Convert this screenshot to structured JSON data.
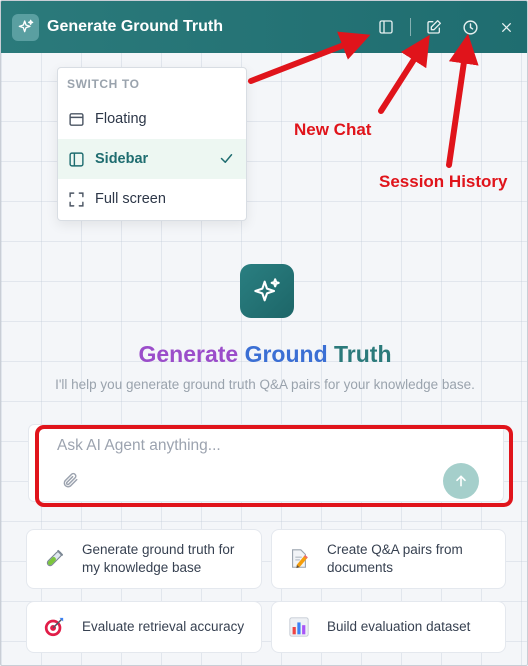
{
  "header": {
    "title": "Generate Ground Truth",
    "icons": [
      "sparkle-icon",
      "sidebar-toggle-icon",
      "new-chat-icon",
      "history-icon",
      "close-icon"
    ]
  },
  "switch_menu": {
    "heading": "SWITCH TO",
    "items": [
      {
        "label": "Floating",
        "icon": "floating-window-icon",
        "active": false
      },
      {
        "label": "Sidebar",
        "icon": "sidebar-icon",
        "active": true
      },
      {
        "label": "Full screen",
        "icon": "fullscreen-icon",
        "active": false
      }
    ]
  },
  "annotations": {
    "new_chat": "New Chat",
    "session_history": "Session History"
  },
  "hero": {
    "title_part1": "Generate",
    "title_part2": "Ground",
    "title_part3": "Truth",
    "subtitle": "I'll help you generate ground truth Q&A pairs for your knowledge base."
  },
  "composer": {
    "placeholder": "Ask AI Agent anything...",
    "value": ""
  },
  "suggestions": [
    {
      "label": "Generate ground truth for my knowledge base",
      "icon": "test-tube-icon"
    },
    {
      "label": "Create Q&A pairs from documents",
      "icon": "document-pencil-icon"
    },
    {
      "label": "Evaluate retrieval accuracy",
      "icon": "target-icon"
    },
    {
      "label": "Build evaluation dataset",
      "icon": "bar-chart-icon"
    }
  ],
  "colors": {
    "header": "#1f6d70",
    "accent": "#2b7a7b",
    "annotation": "#e0141b",
    "active_item_bg": "#edf7f2"
  }
}
